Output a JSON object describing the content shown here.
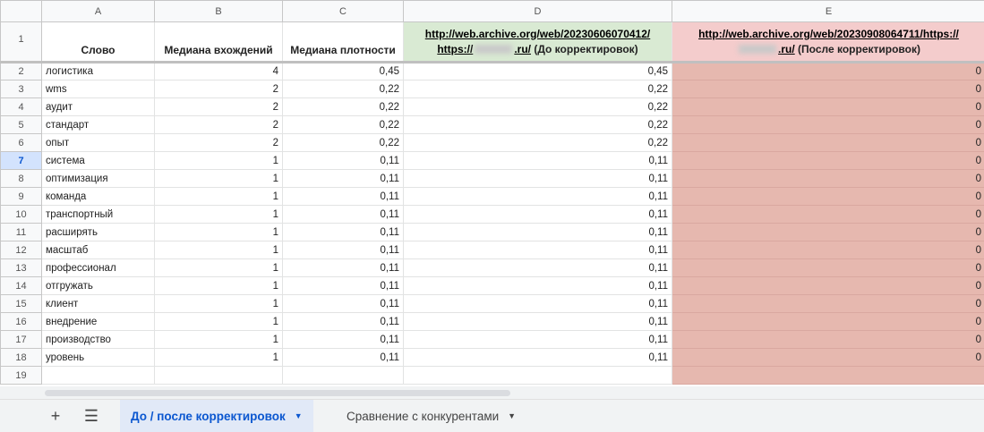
{
  "columns": [
    "A",
    "B",
    "C",
    "D",
    "E"
  ],
  "header_row": {
    "num": "1",
    "a": "Слово",
    "b": "Медиана вхождений",
    "c": "Медиана плотности",
    "d_url_1": "http://web.archive.org/web/20230606070412/",
    "d_url_2": "https://",
    "d_url_3": ".ru/",
    "d_note": "(До корректировок)",
    "e_url_1": "http://web.archive.org/web/20230908064711/https://",
    "e_url_3": ".ru/",
    "e_note": "(После корректировок)"
  },
  "rows": [
    {
      "n": "2",
      "word": "логистика",
      "b": "4",
      "c": "0,45",
      "d": "0,45",
      "e": "0"
    },
    {
      "n": "3",
      "word": "wms",
      "b": "2",
      "c": "0,22",
      "d": "0,22",
      "e": "0"
    },
    {
      "n": "4",
      "word": "аудит",
      "b": "2",
      "c": "0,22",
      "d": "0,22",
      "e": "0"
    },
    {
      "n": "5",
      "word": "стандарт",
      "b": "2",
      "c": "0,22",
      "d": "0,22",
      "e": "0"
    },
    {
      "n": "6",
      "word": "опыт",
      "b": "2",
      "c": "0,22",
      "d": "0,22",
      "e": "0"
    },
    {
      "n": "7",
      "word": "система",
      "b": "1",
      "c": "0,11",
      "d": "0,11",
      "e": "0"
    },
    {
      "n": "8",
      "word": "оптимизация",
      "b": "1",
      "c": "0,11",
      "d": "0,11",
      "e": "0"
    },
    {
      "n": "9",
      "word": "команда",
      "b": "1",
      "c": "0,11",
      "d": "0,11",
      "e": "0"
    },
    {
      "n": "10",
      "word": "транспортный",
      "b": "1",
      "c": "0,11",
      "d": "0,11",
      "e": "0"
    },
    {
      "n": "11",
      "word": "расширять",
      "b": "1",
      "c": "0,11",
      "d": "0,11",
      "e": "0"
    },
    {
      "n": "12",
      "word": "масштаб",
      "b": "1",
      "c": "0,11",
      "d": "0,11",
      "e": "0"
    },
    {
      "n": "13",
      "word": "профессионал",
      "b": "1",
      "c": "0,11",
      "d": "0,11",
      "e": "0"
    },
    {
      "n": "14",
      "word": "отгружать",
      "b": "1",
      "c": "0,11",
      "d": "0,11",
      "e": "0"
    },
    {
      "n": "15",
      "word": "клиент",
      "b": "1",
      "c": "0,11",
      "d": "0,11",
      "e": "0"
    },
    {
      "n": "16",
      "word": "внедрение",
      "b": "1",
      "c": "0,11",
      "d": "0,11",
      "e": "0"
    },
    {
      "n": "17",
      "word": "производство",
      "b": "1",
      "c": "0,11",
      "d": "0,11",
      "e": "0"
    },
    {
      "n": "18",
      "word": "уровень",
      "b": "1",
      "c": "0,11",
      "d": "0,11",
      "e": "0"
    },
    {
      "n": "19",
      "word": "",
      "b": "",
      "c": "",
      "d": "",
      "e": ""
    }
  ],
  "selected_row": "7",
  "tabs": {
    "add_icon": "plus-icon",
    "all_sheets_icon": "menu-icon",
    "sheet_1": "До / после корректировок",
    "sheet_2": "Сравнение с конкурентами"
  },
  "colors": {
    "green": "#d9ead3",
    "pink": "#f4cccc",
    "red": "#e6b8af",
    "active_tab": "#e1e9f7"
  }
}
